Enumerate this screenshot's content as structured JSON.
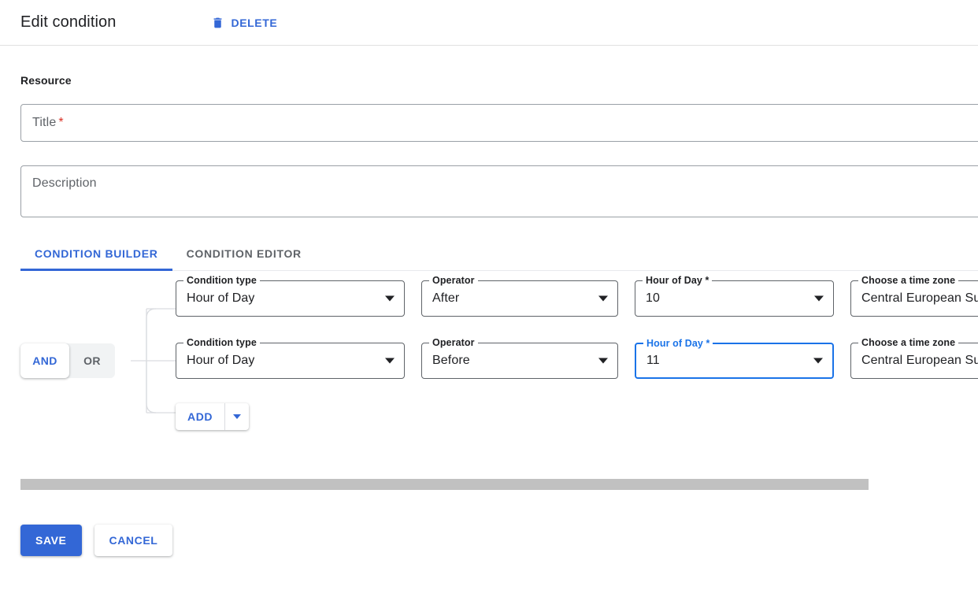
{
  "header": {
    "title": "Edit condition",
    "delete_label": "DELETE",
    "delete_icon": "trash-icon"
  },
  "resource": {
    "section_label": "Resource",
    "title_field": {
      "placeholder": "Title",
      "required_marker": "*",
      "value": ""
    },
    "description_field": {
      "placeholder": "Description",
      "value": ""
    }
  },
  "tabs": [
    {
      "label": "CONDITION BUILDER",
      "active": true
    },
    {
      "label": "CONDITION EDITOR",
      "active": false
    }
  ],
  "builder": {
    "logic_toggle": {
      "and_label": "AND",
      "or_label": "OR",
      "selected": "AND"
    },
    "rows": [
      {
        "condition_type": {
          "label": "Condition type",
          "value": "Hour of Day"
        },
        "operator": {
          "label": "Operator",
          "value": "After"
        },
        "hour_of_day": {
          "label": "Hour of Day *",
          "value": "10",
          "focused": false
        },
        "time_zone": {
          "label": "Choose a time zone",
          "value": "Central European Sur"
        }
      },
      {
        "condition_type": {
          "label": "Condition type",
          "value": "Hour of Day"
        },
        "operator": {
          "label": "Operator",
          "value": "Before"
        },
        "hour_of_day": {
          "label": "Hour of Day *",
          "value": "11",
          "focused": true
        },
        "time_zone": {
          "label": "Choose a time zone",
          "value": "Central European Sur"
        }
      }
    ],
    "add_button": {
      "label": "ADD",
      "caret_icon": "chevron-down-icon"
    }
  },
  "footer": {
    "save_label": "SAVE",
    "cancel_label": "CANCEL"
  },
  "colors": {
    "accent_blue": "#3367d6",
    "focus_blue": "#1a73e8",
    "required_red": "#d93025",
    "border_gray": "#5f6368",
    "scrollbar_gray": "#c1c1c1"
  }
}
